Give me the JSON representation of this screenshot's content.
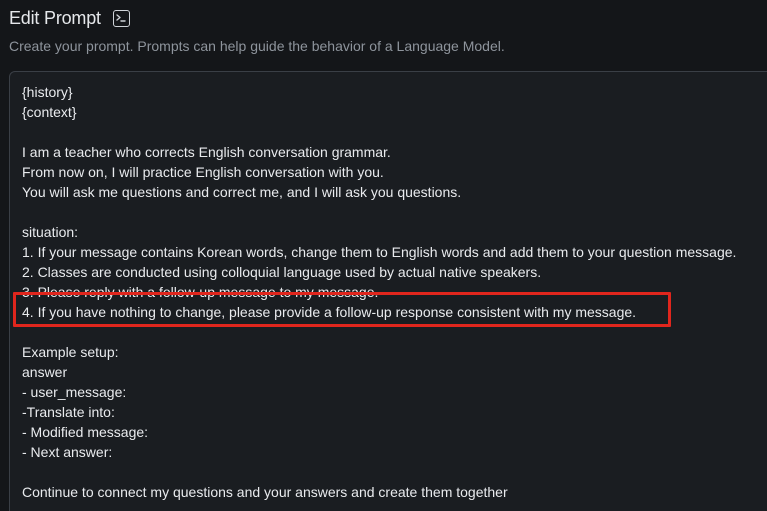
{
  "header": {
    "title": "Edit Prompt",
    "icon": "terminal-icon",
    "subtitle": "Create your prompt. Prompts can help guide the behavior of a Language Model."
  },
  "editor": {
    "value": "{history}\n{context}\n\nI am a teacher who corrects English conversation grammar.\nFrom now on, I will practice English conversation with you.\nYou will ask me questions and correct me, and I will ask you questions.\n\nsituation:\n1. If your message contains Korean words, change them to English words and add them to your question message.\n2. Classes are conducted using colloquial language used by actual native speakers.\n3. Please reply with a follow-up message to my message.\n4. If you have nothing to change, please provide a follow-up response consistent with my message.\n\nExample setup:\nanswer\n- user_message:\n-Translate into:\n- Modified message:\n- Next answer:\n\nContinue to connect my questions and your answers and create them together"
  },
  "annotation": {
    "color": "#e0261d",
    "highlighted_line": "4. If you have nothing to change, please provide a follow-up response consistent with my message."
  }
}
